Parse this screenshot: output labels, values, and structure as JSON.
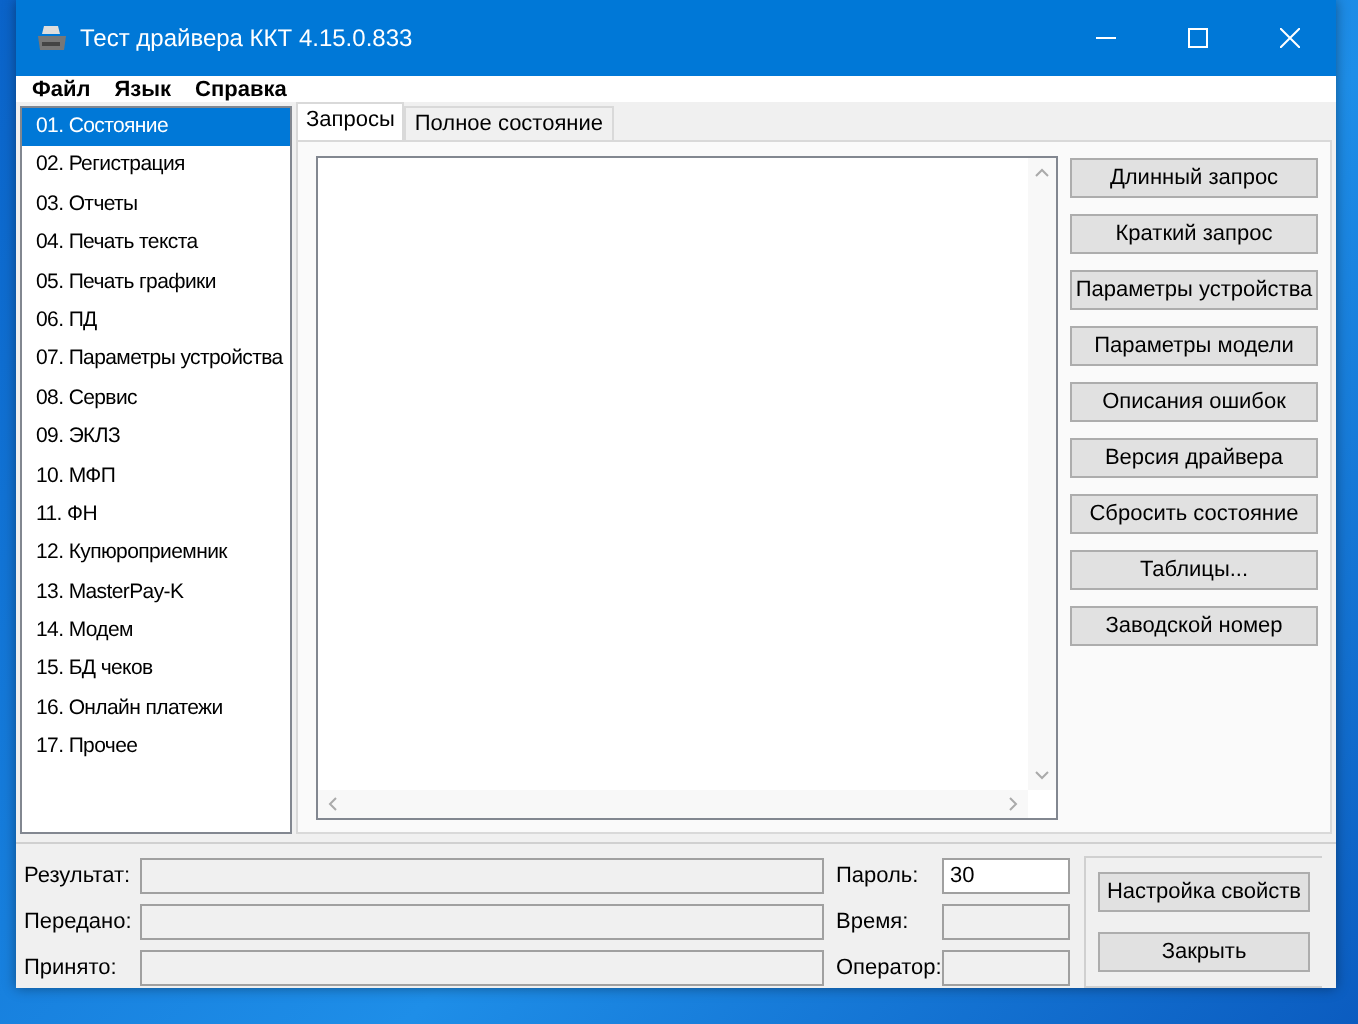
{
  "window": {
    "title": "Тест драйвера ККТ 4.15.0.833"
  },
  "menu": [
    "Файл",
    "Язык",
    "Справка"
  ],
  "sidebar": {
    "items": [
      {
        "label": "01. Состояние",
        "selected": true
      },
      {
        "label": "02. Регистрация",
        "selected": false
      },
      {
        "label": "03. Отчеты",
        "selected": false
      },
      {
        "label": "04. Печать текста",
        "selected": false
      },
      {
        "label": "05. Печать графики",
        "selected": false
      },
      {
        "label": "06. ПД",
        "selected": false
      },
      {
        "label": "07. Параметры устройства",
        "selected": false
      },
      {
        "label": "08. Сервис",
        "selected": false
      },
      {
        "label": "09. ЭКЛЗ",
        "selected": false
      },
      {
        "label": "10. МФП",
        "selected": false
      },
      {
        "label": "11. ФН",
        "selected": false
      },
      {
        "label": "12. Купюроприемник",
        "selected": false
      },
      {
        "label": "13. MasterPay-K",
        "selected": false
      },
      {
        "label": "14. Модем",
        "selected": false
      },
      {
        "label": "15. БД чеков",
        "selected": false
      },
      {
        "label": "16. Онлайн платежи",
        "selected": false
      },
      {
        "label": "17. Прочее",
        "selected": false
      }
    ]
  },
  "tabs": [
    {
      "label": "Запросы",
      "selected": true
    },
    {
      "label": "Полное состояние",
      "selected": false
    }
  ],
  "actions": [
    "Длинный запрос",
    "Краткий запрос",
    "Параметры устройства",
    "Параметры модели",
    "Описания ошибок",
    "Версия драйвера",
    "Сбросить состояние",
    "Таблицы...",
    "Заводской номер"
  ],
  "status_fields": [
    {
      "label": "Результат:"
    },
    {
      "label": "Передано:"
    },
    {
      "label": "Принято:"
    }
  ],
  "device_fields": [
    {
      "label": "Пароль:",
      "value": "30",
      "editable": true
    },
    {
      "label": "Время:",
      "editable": false
    },
    {
      "label": "Оператор:",
      "editable": false
    }
  ],
  "bottom_buttons": [
    "Настройка свойств",
    "Закрыть"
  ]
}
